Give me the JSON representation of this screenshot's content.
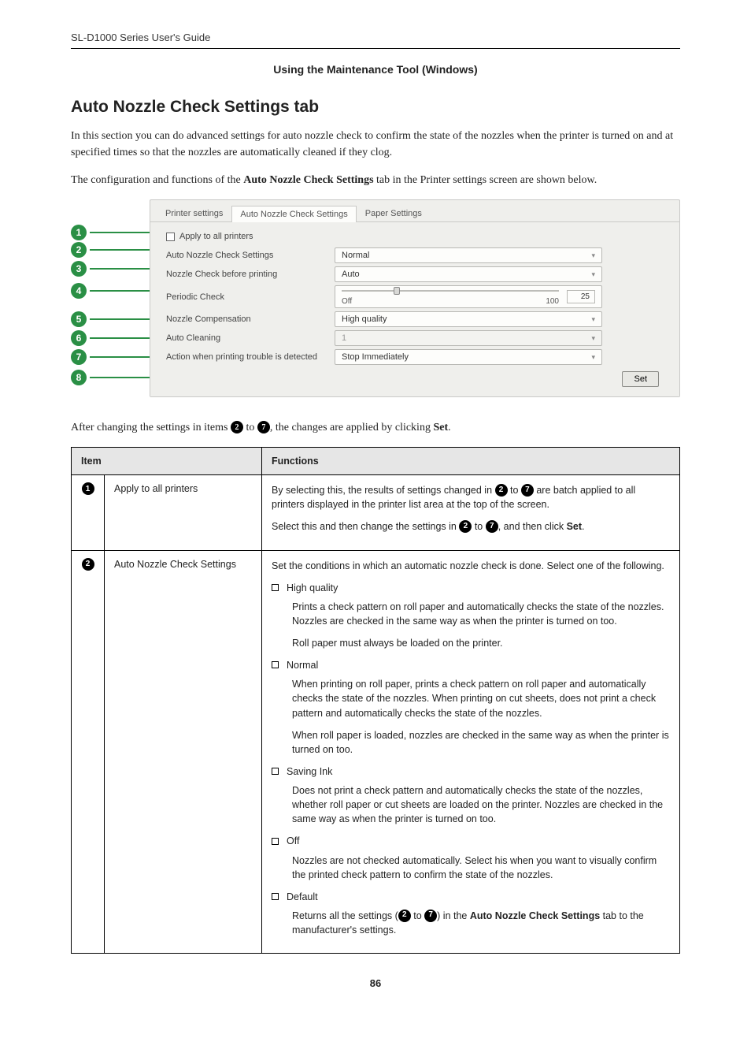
{
  "header": {
    "doc_title": "SL-D1000 Series User's Guide"
  },
  "section_sub": "Using the Maintenance Tool (Windows)",
  "title": "Auto Nozzle Check Settings tab",
  "intro1": "In this section you can do advanced settings for auto nozzle check to confirm the state of the nozzles when the printer is turned on and at specified times so that the nozzles are automatically cleaned if they clog.",
  "intro2_a": "The configuration and functions of the ",
  "intro2_b": "Auto Nozzle Check Settings",
  "intro2_c": " tab in the Printer settings screen are shown below.",
  "figure": {
    "tabs": [
      "Printer settings",
      "Auto Nozzle Check Settings",
      "Paper Settings"
    ],
    "rows": [
      {
        "n": "1",
        "label": "Apply to all printers",
        "type": "checkbox"
      },
      {
        "n": "2",
        "label": "Auto Nozzle Check Settings",
        "value": "Normal",
        "type": "select"
      },
      {
        "n": "3",
        "label": "Nozzle Check before printing",
        "value": "Auto",
        "type": "select"
      },
      {
        "n": "4",
        "label": "Periodic Check",
        "type": "slider",
        "left": "Off",
        "right": "100",
        "sval": "25"
      },
      {
        "n": "5",
        "label": "Nozzle Compensation",
        "value": "High quality",
        "type": "select"
      },
      {
        "n": "6",
        "label": "Auto Cleaning",
        "value": "1",
        "type": "select",
        "disabled": true
      },
      {
        "n": "7",
        "label": "Action when printing trouble is detected",
        "value": "Stop Immediately",
        "type": "select"
      },
      {
        "n": "8",
        "label": "",
        "type": "setbtn",
        "btn": "Set"
      }
    ]
  },
  "after_fig_a": "After changing the settings in items ",
  "after_fig_b": " to ",
  "after_fig_c": ", the changes are applied by clicking ",
  "after_fig_set": "Set",
  "after_fig_d": ".",
  "n2": "2",
  "n7": "7",
  "table": {
    "head_item": "Item",
    "head_func": "Functions",
    "r1": {
      "idx": "1",
      "item": "Apply to all printers",
      "p1a": "By selecting this, the results of settings changed in ",
      "p1b": " to ",
      "p1c": " are batch applied to all printers displayed in the printer list area at the top of the screen.",
      "p2a": "Select this and then change the settings in ",
      "p2b": " to ",
      "p2c": ", and then click ",
      "p2set": "Set",
      "p2d": "."
    },
    "r2": {
      "idx": "2",
      "item": "Auto Nozzle Check Settings",
      "lead": "Set the conditions in which an automatic nozzle check is done. Select one of the following.",
      "o1": "High quality",
      "o1d1": "Prints a check pattern on roll paper and automatically checks the state of the nozzles. Nozzles are checked in the same way as when the printer is turned on too.",
      "o1d2": "Roll paper must always be loaded on the printer.",
      "o2": "Normal",
      "o2d1": "When printing on roll paper, prints a check pattern on roll paper and automatically checks the state of the nozzles. When printing on cut sheets, does not print a check pattern and automatically checks the state of the nozzles.",
      "o2d2": "When roll paper is loaded, nozzles are checked in the same way as when the printer is turned on too.",
      "o3": "Saving Ink",
      "o3d": "Does not print a check pattern and automatically checks the state of the nozzles, whether roll paper or cut sheets are loaded on the printer. Nozzles are checked in the same way as when the printer is turned on too.",
      "o4": "Off",
      "o4d": "Nozzles are not checked automatically. Select his when you want to visually confirm the printed check pattern to confirm the state of the nozzles.",
      "o5": "Default",
      "o5a": "Returns all the settings (",
      "o5b": " to ",
      "o5c": ") in the ",
      "o5tab": "Auto Nozzle Check Settings",
      "o5d": " tab to the manufacturer's settings."
    }
  },
  "pagenum": "86"
}
